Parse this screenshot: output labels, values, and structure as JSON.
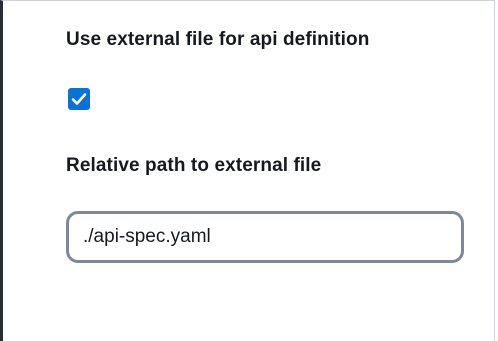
{
  "form": {
    "external_file_label": "Use external file for api definition",
    "external_file_checked": true,
    "relative_path_label": "Relative path to external file",
    "relative_path_value": "./api-spec.yaml"
  },
  "colors": {
    "checkbox_fill": "#0972d3",
    "input_border": "#7d8998",
    "text": "#16191f"
  },
  "icons": {
    "checkbox_mark": "checkmark-icon"
  }
}
